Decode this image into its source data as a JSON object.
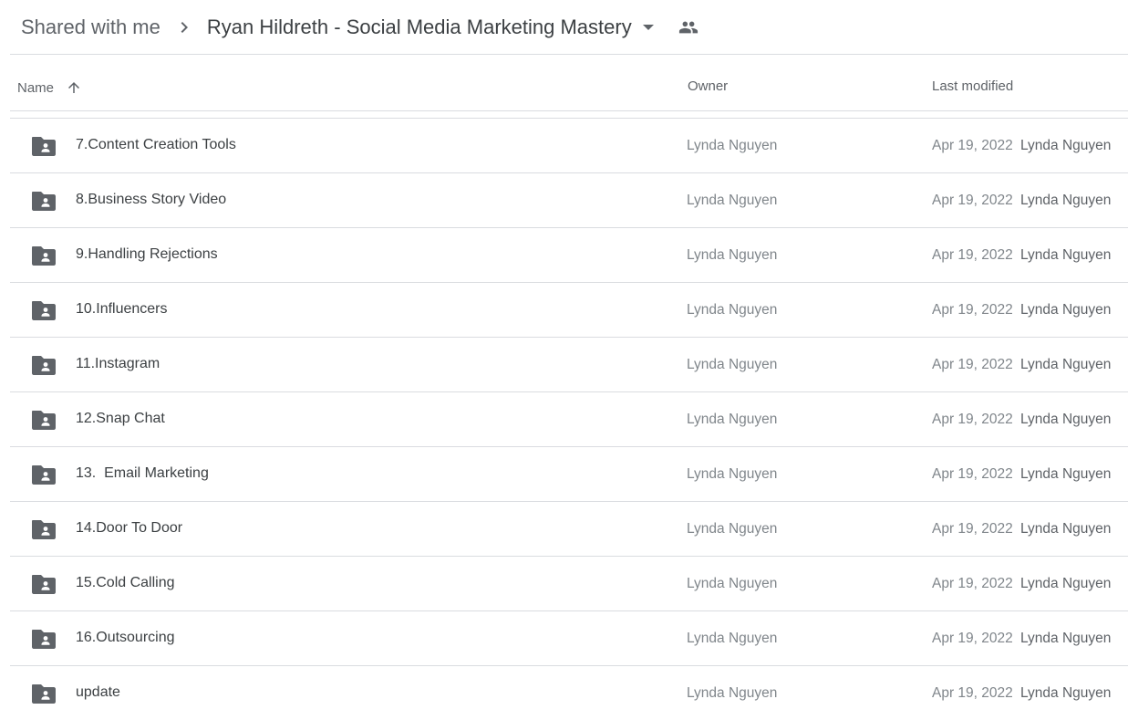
{
  "breadcrumb": {
    "root": "Shared with me",
    "current": "Ryan Hildreth - Social Media Marketing Mastery"
  },
  "columns": {
    "name": "Name",
    "owner": "Owner",
    "modified": "Last modified"
  },
  "colors": {
    "icon": "#5f6368",
    "divider": "#dadce0",
    "text_primary": "#3c4043",
    "text_secondary": "#80868b"
  },
  "rows": [
    {
      "name": "7.Content Creation Tools",
      "owner": "Lynda Nguyen",
      "date": "Apr 19, 2022",
      "modifier": "Lynda Nguyen",
      "icon": "shared-folder-icon"
    },
    {
      "name": "8.Business Story Video",
      "owner": "Lynda Nguyen",
      "date": "Apr 19, 2022",
      "modifier": "Lynda Nguyen",
      "icon": "shared-folder-icon"
    },
    {
      "name": "9.Handling Rejections",
      "owner": "Lynda Nguyen",
      "date": "Apr 19, 2022",
      "modifier": "Lynda Nguyen",
      "icon": "shared-folder-icon"
    },
    {
      "name": "10.Influencers",
      "owner": "Lynda Nguyen",
      "date": "Apr 19, 2022",
      "modifier": "Lynda Nguyen",
      "icon": "shared-folder-icon"
    },
    {
      "name": "11.Instagram",
      "owner": "Lynda Nguyen",
      "date": "Apr 19, 2022",
      "modifier": "Lynda Nguyen",
      "icon": "shared-folder-icon"
    },
    {
      "name": "12.Snap Chat",
      "owner": "Lynda Nguyen",
      "date": "Apr 19, 2022",
      "modifier": "Lynda Nguyen",
      "icon": "shared-folder-icon"
    },
    {
      "name": "13.  Email Marketing",
      "owner": "Lynda Nguyen",
      "date": "Apr 19, 2022",
      "modifier": "Lynda Nguyen",
      "icon": "shared-folder-icon"
    },
    {
      "name": "14.Door To Door",
      "owner": "Lynda Nguyen",
      "date": "Apr 19, 2022",
      "modifier": "Lynda Nguyen",
      "icon": "shared-folder-icon"
    },
    {
      "name": "15.Cold Calling",
      "owner": "Lynda Nguyen",
      "date": "Apr 19, 2022",
      "modifier": "Lynda Nguyen",
      "icon": "shared-folder-icon"
    },
    {
      "name": "16.Outsourcing",
      "owner": "Lynda Nguyen",
      "date": "Apr 19, 2022",
      "modifier": "Lynda Nguyen",
      "icon": "shared-folder-icon"
    },
    {
      "name": "update",
      "owner": "Lynda Nguyen",
      "date": "Apr 19, 2022",
      "modifier": "Lynda Nguyen",
      "icon": "shared-folder-icon"
    }
  ]
}
